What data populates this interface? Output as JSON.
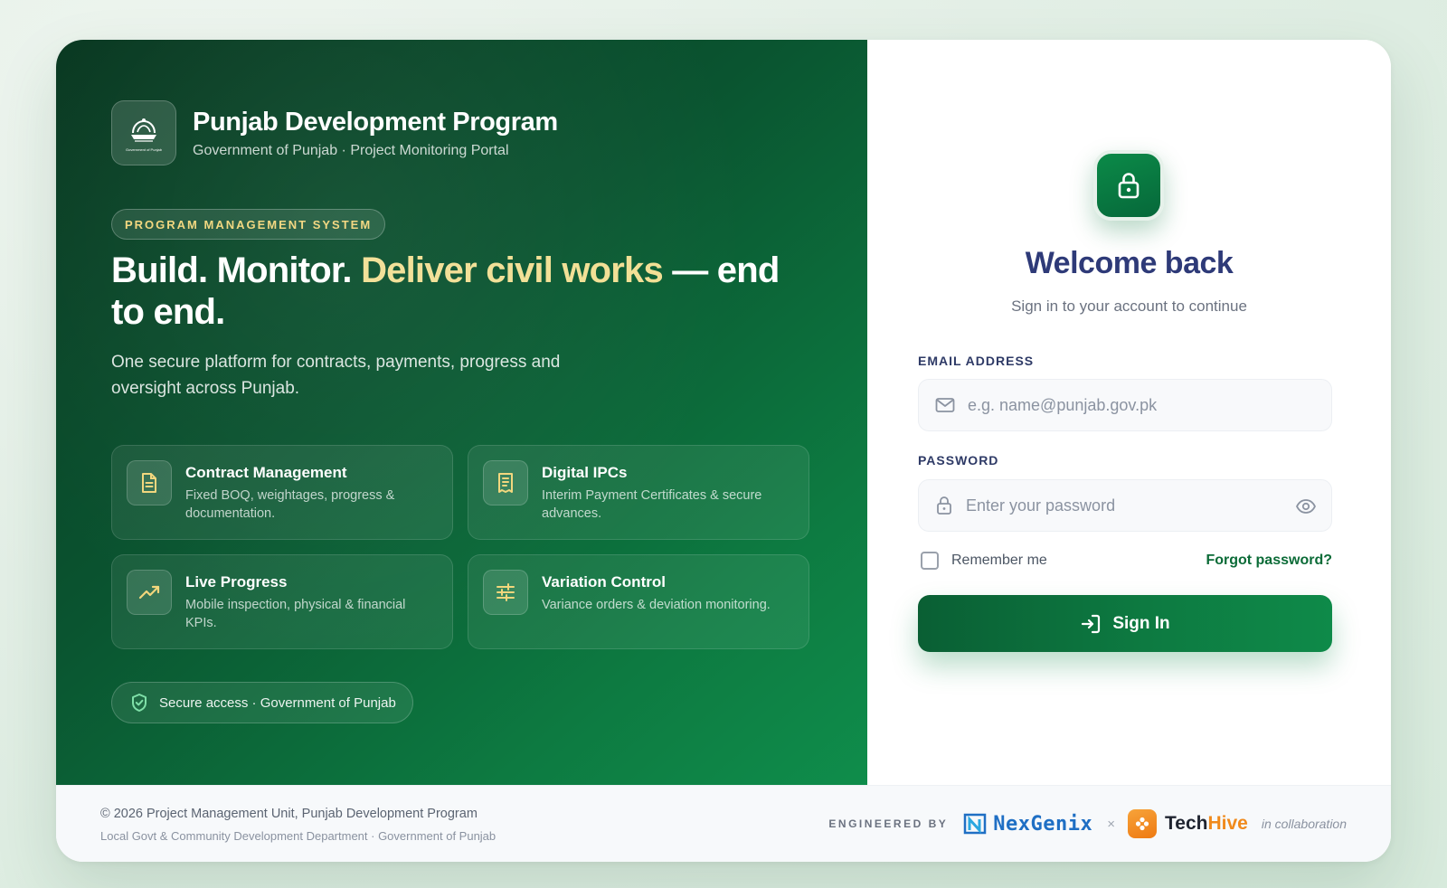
{
  "brand": {
    "title": "Punjab Development Program",
    "subtitle": "Government of Punjab · Project Monitoring Portal",
    "logo_caption": "Government of Punjab"
  },
  "hero": {
    "pill": "PROGRAM MANAGEMENT SYSTEM",
    "headline_part1": "Build. Monitor. ",
    "headline_accent": "Deliver civil works",
    "headline_part2": " — end to end.",
    "lead": "One secure platform for contracts, payments, progress and oversight across Punjab.",
    "features": [
      {
        "title": "Contract Management",
        "desc": "Fixed BOQ, weightages, progress & documentation.",
        "icon": "document-icon"
      },
      {
        "title": "Digital IPCs",
        "desc": "Interim Payment Certificates & secure advances.",
        "icon": "receipt-icon"
      },
      {
        "title": "Live Progress",
        "desc": "Mobile inspection, physical & financial KPIs.",
        "icon": "trending-up-icon"
      },
      {
        "title": "Variation Control",
        "desc": "Variance orders & deviation monitoring.",
        "icon": "sliders-icon"
      }
    ],
    "secure_badge": "Secure access · Government of Punjab"
  },
  "login": {
    "title": "Welcome back",
    "subtitle": "Sign in to your account to continue",
    "email_label": "EMAIL ADDRESS",
    "email_placeholder": "e.g. name@punjab.gov.pk",
    "email_value": "",
    "password_label": "PASSWORD",
    "password_placeholder": "Enter your password",
    "password_value": "",
    "remember_label": "Remember me",
    "remember_checked": false,
    "forgot_label": "Forgot password?",
    "submit_label": "Sign In"
  },
  "footer": {
    "copyright": "© 2026 Project Management Unit, Punjab Development Program",
    "department": "Local Govt & Community Development Department · Government of Punjab",
    "engineered_by": "ENGINEERED BY",
    "partner1": "NexGenix",
    "separator": "×",
    "partner2_a": "Tech",
    "partner2_b": "Hive",
    "collab": "in collaboration"
  },
  "colors": {
    "brand_green": "#0d7a41",
    "accent_gold": "#f2df94",
    "heading_navy": "#2e3a78",
    "link_green": "#0b6b37",
    "nexgenix_blue": "#1f6fc4",
    "techhive_orange": "#f08a1c"
  }
}
